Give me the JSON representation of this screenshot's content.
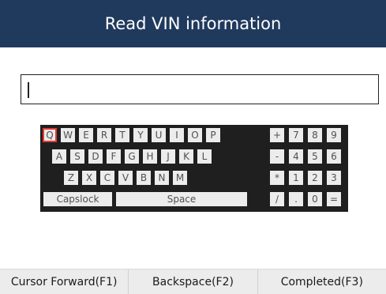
{
  "header": {
    "title": "Read VIN information"
  },
  "vin": {
    "value": ""
  },
  "keyboard": {
    "selected_key": "Q",
    "row1": [
      "Q",
      "W",
      "E",
      "R",
      "T",
      "Y",
      "U",
      "I",
      "O",
      "P"
    ],
    "row2": [
      "A",
      "S",
      "D",
      "F",
      "G",
      "H",
      "J",
      "K",
      "L"
    ],
    "row3": [
      "Z",
      "X",
      "C",
      "V",
      "B",
      "N",
      "M"
    ],
    "capslock": "Capslock",
    "space": "Space",
    "numpad": [
      [
        "+",
        "7",
        "8",
        "9"
      ],
      [
        "-",
        "4",
        "5",
        "6"
      ],
      [
        "*",
        "1",
        "2",
        "3"
      ],
      [
        "/",
        ".",
        "0",
        "="
      ]
    ]
  },
  "footer": {
    "f1": "Cursor Forward(F1)",
    "f2": "Backspace(F2)",
    "f3": "Completed(F3)"
  }
}
